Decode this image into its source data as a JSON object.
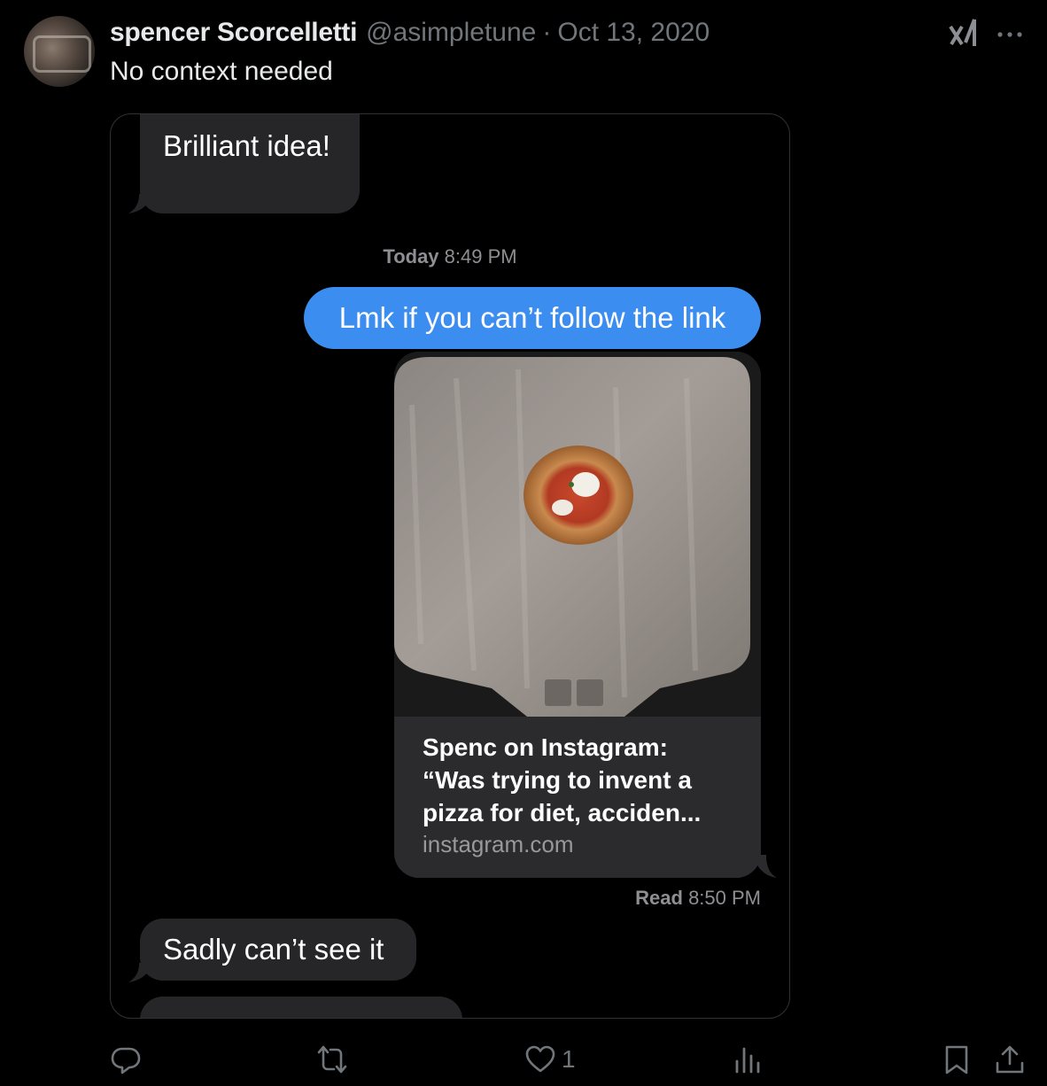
{
  "tweet": {
    "author_name": "spencer Scorcelletti",
    "author_handle": "@asimpletune",
    "separator": "·",
    "date": "Oct 13, 2020",
    "text": "No context needed",
    "like_count": "1"
  },
  "conversation": {
    "bubble1": "Brilliant idea!",
    "timestamp_day": "Today",
    "timestamp_time": "8:49 PM",
    "outgoing_message": "Lmk if you can’t follow the link",
    "link_title": "Spenc on Instagram: “Was trying to invent a pizza for diet, acciden...",
    "link_domain": "instagram.com",
    "read_label": "Read",
    "read_time": "8:50 PM",
    "bubble2": "Sadly can’t see it"
  },
  "icons": [
    "grok-icon",
    "more-icon",
    "reply-icon",
    "retweet-icon",
    "like-icon",
    "views-icon",
    "bookmark-icon",
    "share-icon"
  ],
  "colors": {
    "background": "#000000",
    "text_primary": "#e7e9ea",
    "text_secondary": "#71767b",
    "imessage_blue": "#3b8ef0",
    "incoming_bubble": "#262628"
  }
}
